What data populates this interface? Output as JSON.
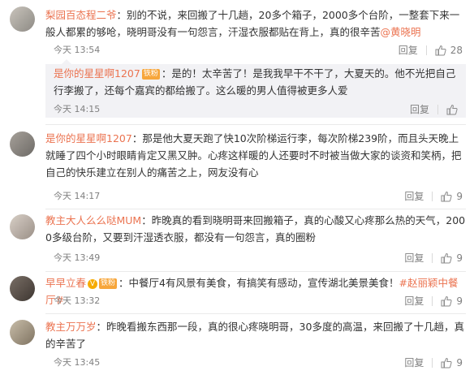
{
  "comments": [
    {
      "name": "梨园百态程二爷",
      "colon": "：",
      "text": "别的不说，来回搬了十几趟，20多个箱子，2000多个台阶，一整套下来一般人都累的够呛，晓明哥没有一句怨言，汗湿衣服都贴在背上，真的很辛苦",
      "mention": "@黄晓明",
      "time": "今天 13:54",
      "reply_label": "回复",
      "likes": "28"
    },
    {
      "name": "是你的星星啊1207",
      "badge1": "铁粉",
      "colon": "：",
      "text": "是的！太辛苦了！是我我早干不干了，大夏天的。他不光把自己行李搬了，还每个嘉宾的都给搬了。这么暖的男人值得被更多人爱",
      "time": "今天 14:15",
      "reply_label": "回复"
    },
    {
      "name": "是你的星星啊1207",
      "colon": "：",
      "text": "那是他大夏天跑了快10次阶梯运行李，每次阶梯239阶，而且头天晚上就睡了四个小时眼睛肯定又黑又肿。心疼这样暖的人还要时不时被当做大家的谈资和笑柄，把自己的快乐建立在别人的痛苦之上，网友没有心",
      "time": "今天 14:17",
      "reply_label": "回复",
      "likes": "9"
    },
    {
      "name": "教主大人么么哒MUM",
      "colon": "：",
      "text": "昨晚真的看到晓明哥来回搬箱子，真的心酸又心疼那么热的天气，2000多级台阶，又要到汗湿透衣服，都没有一句怨言，真的圈粉",
      "time": "今天 13:49",
      "reply_label": "回复",
      "likes": "9"
    },
    {
      "name": "早早立春",
      "vip": "V",
      "badge1": "铁粉",
      "colon": "：",
      "text": "中餐厅4有风景有美食，有搞笑有感动，宣传湖北美景美食！",
      "hashtag": "#赵丽颖中餐厅#",
      "time": "今天 13:32",
      "reply_label": "回复",
      "likes": "9"
    },
    {
      "name": "教主万万岁",
      "colon": "：",
      "text": "昨晚看搬东西那一段，真的很心疼晓明哥，30多度的高温，来回搬了十几趟，真的辛苦了",
      "time": "今天 13:45",
      "reply_label": "回复",
      "likes": "9"
    }
  ],
  "icons": {
    "like": "thumbs-up-icon",
    "reply": "reply"
  },
  "colors": {
    "name": "#eb7350",
    "meta": "#808080",
    "reply_bg": "#f2f2f5"
  }
}
